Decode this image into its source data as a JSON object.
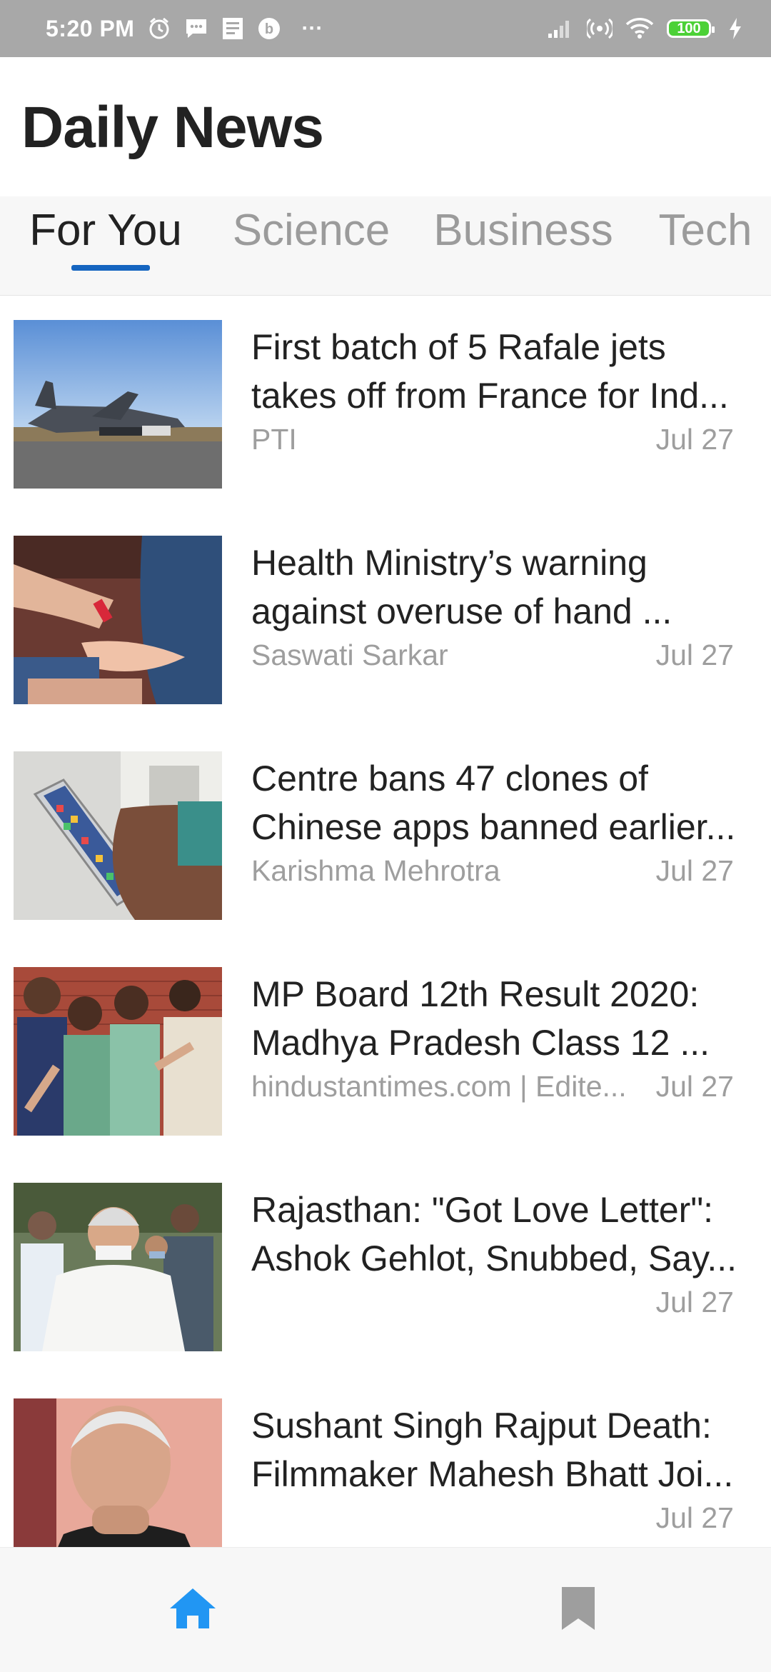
{
  "status_bar": {
    "time": "5:20 PM",
    "battery_level": "100",
    "more": "···",
    "icons": [
      "alarm-icon",
      "message-icon",
      "news-icon",
      "app-badge-icon",
      "signal-icon",
      "hotspot-icon",
      "wifi-icon",
      "battery-icon",
      "charging-icon"
    ]
  },
  "header": {
    "title": "Daily News"
  },
  "tabs": [
    {
      "label": "For You",
      "active": true
    },
    {
      "label": "Science",
      "active": false
    },
    {
      "label": "Business",
      "active": false
    },
    {
      "label": "Tech",
      "active": false
    }
  ],
  "articles": [
    {
      "headline": "First batch of 5 Rafale jets takes off from France for Ind...",
      "source": "PTI",
      "date": "Jul 27",
      "image": "rafale-jet-photo"
    },
    {
      "headline": "Health Ministry’s warning against overuse of hand ...",
      "source": "Saswati Sarkar",
      "date": "Jul 27",
      "image": "hand-sanitizer-photo"
    },
    {
      "headline": "Centre bans 47 clones of Chinese apps banned earlier...",
      "source": "Karishma Mehrotra",
      "date": "Jul 27",
      "image": "smartphone-photo"
    },
    {
      "headline": "MP Board 12th Result 2020: Madhya Pradesh Class 12 ...",
      "source": "hindustantimes.com | Edite...",
      "date": "Jul 27",
      "image": "students-celebrating-photo"
    },
    {
      "headline": "Rajasthan: \"Got Love Letter\": Ashok Gehlot, Snubbed, Say...",
      "source": "",
      "date": "Jul 27",
      "image": "politician-crowd-photo"
    },
    {
      "headline": "Sushant Singh Rajput Death: Filmmaker Mahesh Bhatt Joi...",
      "source": "",
      "date": "Jul 27",
      "image": "filmmaker-portrait-photo"
    }
  ],
  "bottom_nav": {
    "items": [
      {
        "icon": "home-icon",
        "active": true
      },
      {
        "icon": "bookmark-icon",
        "active": false
      }
    ]
  },
  "colors": {
    "accent": "#1565c0",
    "nav_active": "#2196f3",
    "nav_inactive": "#9e9e9e",
    "status_bar": "#a8a8a8",
    "battery": "#4cd137"
  }
}
